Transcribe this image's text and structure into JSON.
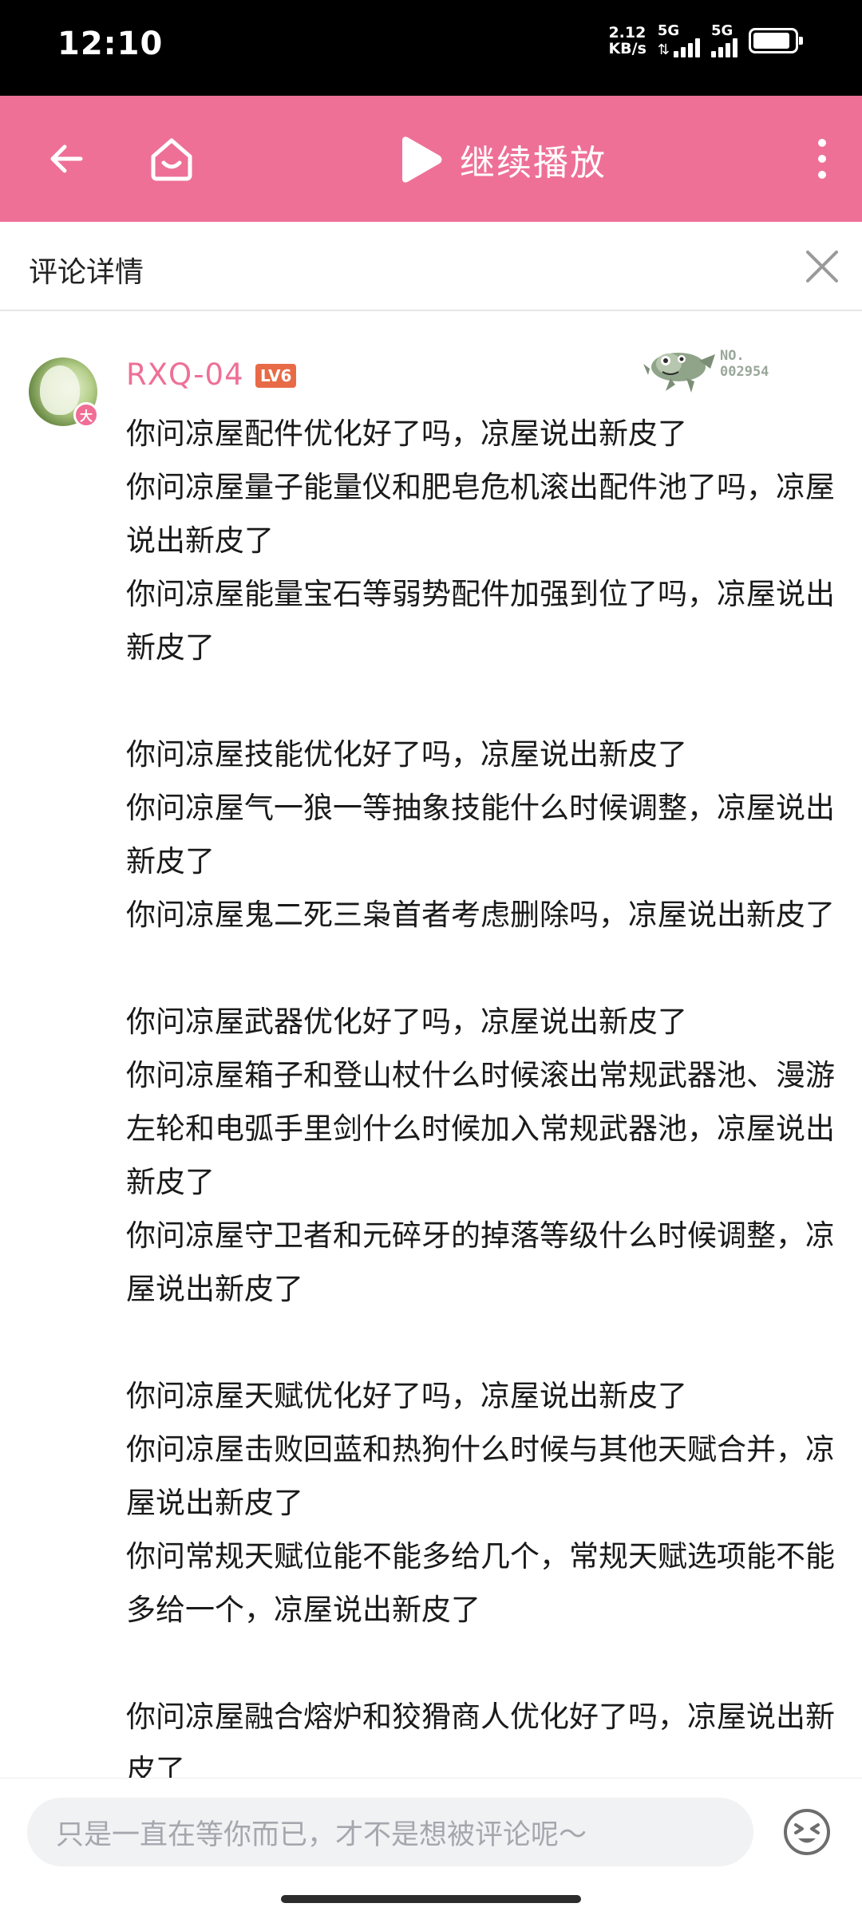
{
  "status_bar": {
    "time": "12:10",
    "net_speed_value": "2.12",
    "net_speed_unit": "KB/s",
    "sim1_label": "5G",
    "sim2_label": "5G",
    "battery_level": 0.9
  },
  "topbar": {
    "play_label": "继续播放",
    "icons": [
      "back-arrow-icon",
      "home-icon",
      "play-icon",
      "more-vert-icon"
    ],
    "background_color": "#ee7097"
  },
  "subheader": {
    "title": "评论详情",
    "close_icon": "close-icon"
  },
  "comment": {
    "username": "RXQ-04",
    "level": "LV6",
    "avatar_badge": "大",
    "fan_badge_line1": "NO.",
    "fan_badge_line2": "002954",
    "username_color": "#ee7097",
    "body": "你问凉屋配件优化好了吗，凉屋说出新皮了\n你问凉屋量子能量仪和肥皂危机滚出配件池了吗，凉屋说出新皮了\n你问凉屋能量宝石等弱势配件加强到位了吗，凉屋说出新皮了\n\n你问凉屋技能优化好了吗，凉屋说出新皮了\n你问凉屋气一狼一等抽象技能什么时候调整，凉屋说出新皮了\n你问凉屋鬼二死三枭首者考虑删除吗，凉屋说出新皮了\n\n你问凉屋武器优化好了吗，凉屋说出新皮了\n你问凉屋箱子和登山杖什么时候滚出常规武器池、漫游左轮和电弧手里剑什么时候加入常规武器池，凉屋说出新皮了\n你问凉屋守卫者和元碎牙的掉落等级什么时候调整，凉屋说出新皮了\n\n你问凉屋天赋优化好了吗，凉屋说出新皮了\n你问凉屋击败回蓝和热狗什么时候与其他天赋合并，凉屋说出新皮了\n你问常规天赋位能不能多给几个，常规天赋选项能不能多给一个，凉屋说出新皮了\n\n你问凉屋融合熔炉和狡猾商人优化好了吗，凉屋说出新皮了"
  },
  "bottom": {
    "input_placeholder": "只是一直在等你而已，才不是想被评论呢～",
    "emoji_icon": "emoji-face-icon"
  }
}
